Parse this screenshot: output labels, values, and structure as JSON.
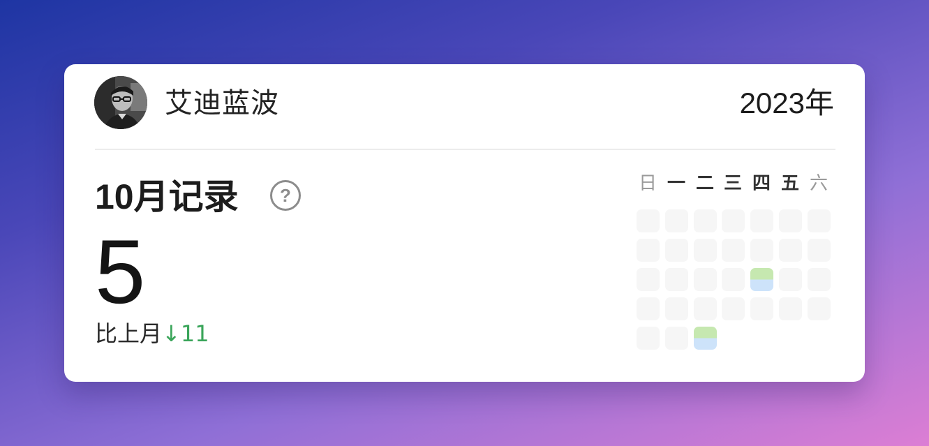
{
  "profile": {
    "name": "艾迪蓝波",
    "avatar_icon": "user-avatar-photo"
  },
  "header": {
    "year": "2023年"
  },
  "summary": {
    "title": "10月记录",
    "help_icon": "question-circle-icon",
    "help_glyph": "?",
    "count": "5",
    "compare_label": "比上月",
    "compare_delta": "↓11",
    "delta_color": "#3aa55a"
  },
  "calendar": {
    "weekdays": [
      "日",
      "一",
      "二",
      "三",
      "四",
      "五",
      "六"
    ],
    "weekend_color": "#9a9a9a",
    "rows": [
      [
        false,
        false,
        false,
        false,
        false,
        false,
        false
      ],
      [
        false,
        false,
        false,
        false,
        false,
        false,
        false
      ],
      [
        false,
        false,
        false,
        false,
        true,
        false,
        false
      ],
      [
        false,
        false,
        false,
        false,
        false,
        false,
        false
      ],
      [
        false,
        false,
        true
      ]
    ],
    "active_colors": [
      "#c6e8b0",
      "#cde3fa"
    ]
  }
}
